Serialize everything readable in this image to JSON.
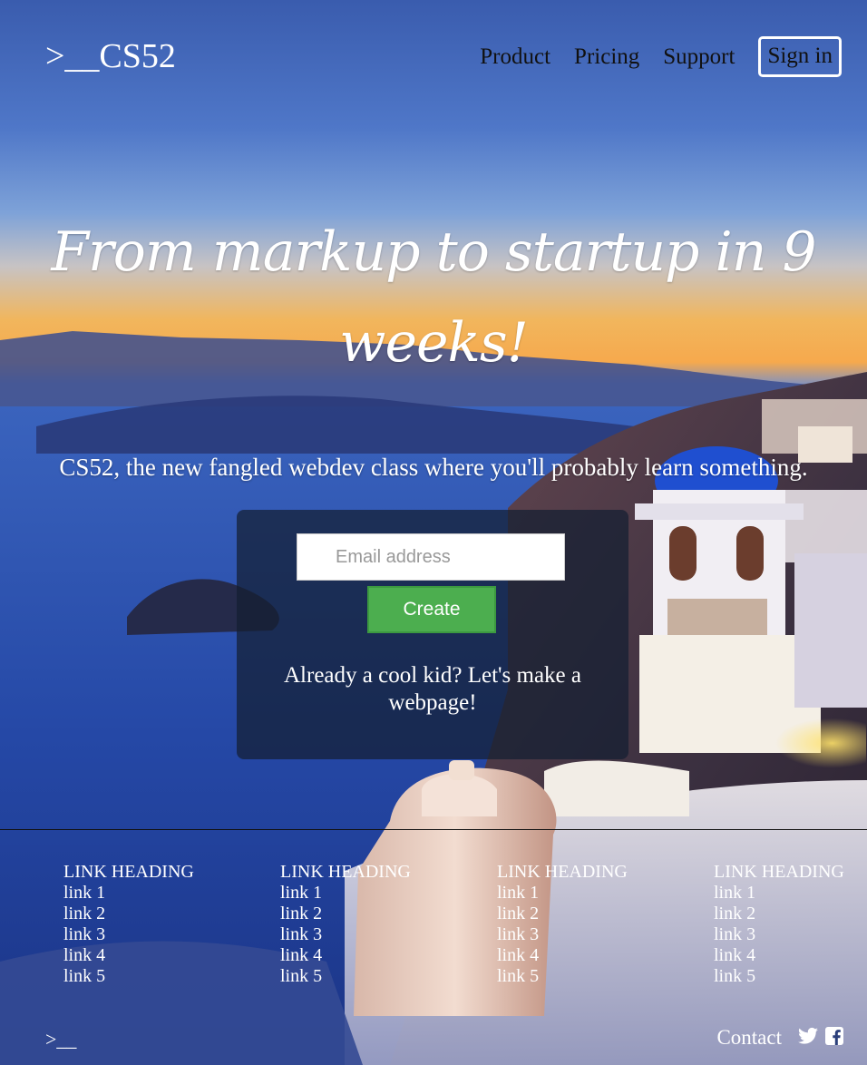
{
  "header": {
    "logo": ">__CS52",
    "nav": [
      {
        "label": "Product"
      },
      {
        "label": "Pricing"
      },
      {
        "label": "Support"
      }
    ],
    "signin_label": "Sign in"
  },
  "hero": {
    "headline": "From markup to startup in 9 weeks!",
    "subline": "CS52, the new fangled webdev class where you'll probably learn something."
  },
  "signup": {
    "email_placeholder": "Email address",
    "email_value": "",
    "create_label": "Create",
    "cool_kid_text": "Already a cool kid? Let's make a webpage!"
  },
  "footer": {
    "columns": [
      {
        "heading": "LINK HEADING",
        "links": [
          "link 1",
          "link 2",
          "link 3",
          "link 4",
          "link 5"
        ]
      },
      {
        "heading": "LINK HEADING",
        "links": [
          "link 1",
          "link 2",
          "link 3",
          "link 4",
          "link 5"
        ]
      },
      {
        "heading": "LINK HEADING",
        "links": [
          "link 1",
          "link 2",
          "link 3",
          "link 4",
          "link 5"
        ]
      },
      {
        "heading": "LINK HEADING",
        "links": [
          "link 1",
          "link 2",
          "link 3",
          "link 4",
          "link 5"
        ]
      }
    ],
    "logo": ">__",
    "contact_label": "Contact",
    "icons": [
      "twitter-icon",
      "facebook-icon"
    ]
  },
  "colors": {
    "create_button": "#4cae4f",
    "panel": "rgba(20,30,50,0.72)",
    "sky_top": "#3c5fb0",
    "sunset": "#f3b55a",
    "sea": "#1e3f9e",
    "dome": "#1f4fd0"
  }
}
